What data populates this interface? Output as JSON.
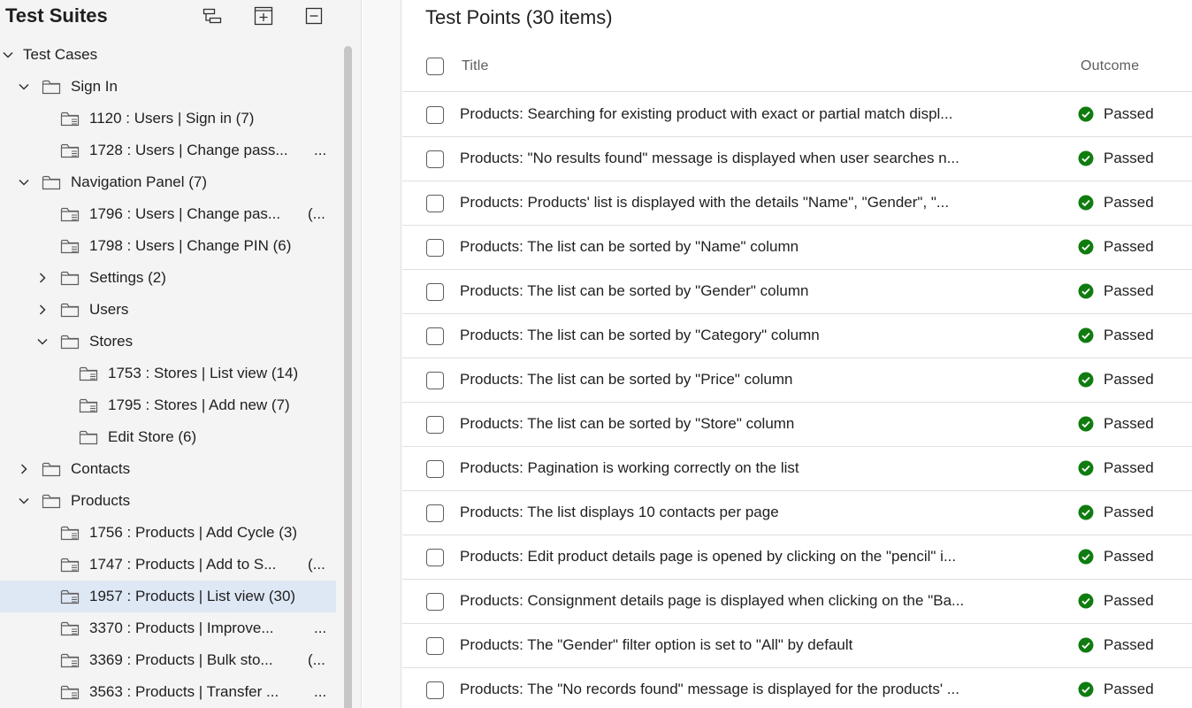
{
  "left_pane": {
    "title": "Test Suites",
    "tree": [
      {
        "label": "Test Cases",
        "chevron": "down",
        "level": 0,
        "icon": "none"
      },
      {
        "label": "Sign In",
        "chevron": "down",
        "level": 1,
        "icon": "folder-icon"
      },
      {
        "label": "1120 : Users | Sign in (7)",
        "chevron": "none",
        "level": 2,
        "icon": "requirement-suite-icon"
      },
      {
        "label": "1728 : Users | Change pass...",
        "ellipsis": "...",
        "chevron": "none",
        "level": 2,
        "icon": "requirement-suite-icon"
      },
      {
        "label": "Navigation Panel (7)",
        "chevron": "down",
        "level": 1,
        "icon": "folder-icon"
      },
      {
        "label": "1796 : Users | Change pas...",
        "ellipsis": "(...",
        "chevron": "none",
        "level": 2,
        "icon": "requirement-suite-icon"
      },
      {
        "label": "1798 : Users | Change PIN (6)",
        "chevron": "none",
        "level": 2,
        "icon": "requirement-suite-icon"
      },
      {
        "label": "Settings (2)",
        "chevron": "right",
        "level": 2,
        "icon": "folder-icon"
      },
      {
        "label": "Users",
        "chevron": "right",
        "level": 2,
        "icon": "folder-icon"
      },
      {
        "label": "Stores",
        "chevron": "down",
        "level": 2,
        "icon": "folder-icon"
      },
      {
        "label": "1753 : Stores | List view (14)",
        "chevron": "none",
        "level": 3,
        "icon": "requirement-suite-icon"
      },
      {
        "label": "1795 : Stores | Add new (7)",
        "chevron": "none",
        "level": 3,
        "icon": "requirement-suite-icon"
      },
      {
        "label": "Edit Store (6)",
        "chevron": "none",
        "level": 3,
        "icon": "folder-icon"
      },
      {
        "label": "Contacts",
        "chevron": "right",
        "level": 1,
        "icon": "folder-icon"
      },
      {
        "label": "Products",
        "chevron": "down",
        "level": 1,
        "icon": "folder-icon"
      },
      {
        "label": "1756 : Products | Add Cycle (3)",
        "chevron": "none",
        "level": 2,
        "icon": "requirement-suite-icon"
      },
      {
        "label": "1747 : Products | Add to S...",
        "ellipsis": "(...",
        "chevron": "none",
        "level": 2,
        "icon": "requirement-suite-icon"
      },
      {
        "label": "1957 : Products | List view (30)",
        "chevron": "none",
        "level": 2,
        "icon": "requirement-suite-icon",
        "selected": true
      },
      {
        "label": "3370 : Products | Improve...",
        "ellipsis": "...",
        "chevron": "none",
        "level": 2,
        "icon": "requirement-suite-icon"
      },
      {
        "label": "3369 : Products | Bulk sto...",
        "ellipsis": "(...",
        "chevron": "none",
        "level": 2,
        "icon": "requirement-suite-icon"
      },
      {
        "label": "3563 : Products | Transfer ...",
        "ellipsis": "...",
        "chevron": "none",
        "level": 2,
        "icon": "requirement-suite-icon"
      }
    ]
  },
  "right_pane": {
    "title": "Test Points (30 items)",
    "columns": {
      "title": "Title",
      "outcome": "Outcome"
    },
    "rows": [
      {
        "title": "Products: Searching for existing product with exact or partial match displ...",
        "outcome": "Passed"
      },
      {
        "title": "Products: \"No results found\" message is displayed when user searches n...",
        "outcome": "Passed"
      },
      {
        "title": "Products: Products' list is displayed with the details \"Name\", \"Gender\", \"...",
        "outcome": "Passed"
      },
      {
        "title": "Products: The list can be sorted by \"Name\" column",
        "outcome": "Passed"
      },
      {
        "title": "Products: The list can be sorted by \"Gender\" column",
        "outcome": "Passed"
      },
      {
        "title": "Products: The list can be sorted by \"Category\" column",
        "outcome": "Passed"
      },
      {
        "title": "Products: The list can be sorted by \"Price\" column",
        "outcome": "Passed"
      },
      {
        "title": "Products: The list can be sorted by \"Store\" column",
        "outcome": "Passed"
      },
      {
        "title": "Products: Pagination is working correctly on the list",
        "outcome": "Passed"
      },
      {
        "title": "Products: The list displays 10 contacts per page",
        "outcome": "Passed"
      },
      {
        "title": "Products: Edit product details page is opened by clicking on the \"pencil\" i...",
        "outcome": "Passed"
      },
      {
        "title": "Products: Consignment details page is displayed when clicking on the \"Ba...",
        "outcome": "Passed"
      },
      {
        "title": "Products: The \"Gender\" filter option is set to \"All\" by default",
        "outcome": "Passed"
      },
      {
        "title": "Products: The \"No records found\" message is displayed for the products' ...",
        "outcome": "Passed"
      }
    ]
  },
  "colors": {
    "passed": "#107c10",
    "selected_row": "#dee8f5",
    "pane_bg": "#f4f4f4"
  }
}
